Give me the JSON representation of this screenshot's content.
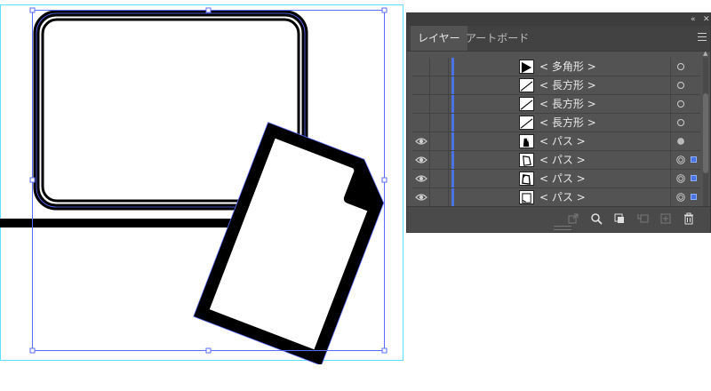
{
  "panel": {
    "collapse_glyph": "«",
    "close_glyph": "✕",
    "tabs": [
      {
        "label": "レイヤー",
        "active": true
      },
      {
        "label": "アートボード",
        "active": false
      }
    ],
    "menu_icon": "hamburger-menu-icon",
    "layer_color": "#4a74e6",
    "rows": [
      {
        "name": "< 多角形 >",
        "visible": false,
        "thumb": "polygon",
        "target": "empty",
        "selected": false
      },
      {
        "name": "< 長方形 >",
        "visible": false,
        "thumb": "rect-diag",
        "target": "empty",
        "selected": false
      },
      {
        "name": "< 長方形 >",
        "visible": false,
        "thumb": "rect-diag",
        "target": "empty",
        "selected": false
      },
      {
        "name": "< 長方形 >",
        "visible": false,
        "thumb": "rect-diag",
        "target": "empty",
        "selected": false
      },
      {
        "name": "< パス >",
        "visible": true,
        "thumb": "path-corner",
        "target": "filled",
        "selected": false
      },
      {
        "name": "< パス >",
        "visible": true,
        "thumb": "path-page",
        "target": "double",
        "selected": true
      },
      {
        "name": "< パス >",
        "visible": true,
        "thumb": "path-page2",
        "target": "double",
        "selected": true
      },
      {
        "name": "< パス >",
        "visible": true,
        "thumb": "path-page3",
        "target": "double",
        "selected": true
      }
    ],
    "footer_icons": [
      "export-icon",
      "search-icon",
      "clipping-mask-icon",
      "new-sublayer-icon",
      "new-layer-icon",
      "trash-icon"
    ]
  }
}
